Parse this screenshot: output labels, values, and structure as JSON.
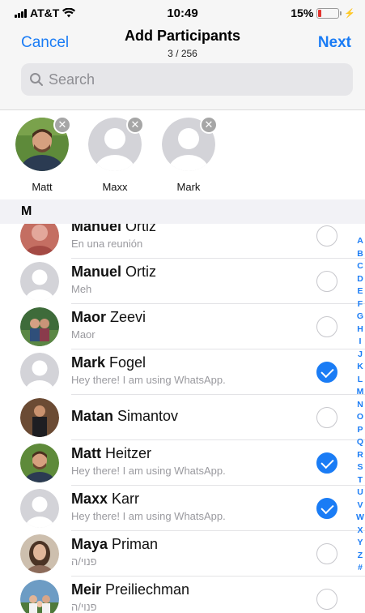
{
  "status_bar": {
    "carrier": "AT&T",
    "time": "10:49",
    "battery_percent_text": "15%",
    "battery_level": 0.15
  },
  "header": {
    "cancel_label": "Cancel",
    "title": "Add Participants",
    "count": "3 / 256",
    "next_label": "Next"
  },
  "search": {
    "placeholder": "Search",
    "value": ""
  },
  "selected": [
    {
      "name": "Matt",
      "avatar": "photo"
    },
    {
      "name": "Maxx",
      "avatar": "placeholder"
    },
    {
      "name": "Mark",
      "avatar": "placeholder"
    }
  ],
  "section_letter": "M",
  "contacts": [
    {
      "first": "Manuel",
      "last": " Ortiz",
      "status": "En una reunión",
      "checked": false,
      "avatar": "photo"
    },
    {
      "first": "Manuel",
      "last": " Ortiz",
      "status": "Meh",
      "checked": false,
      "avatar": "placeholder"
    },
    {
      "first": "Maor",
      "last": " Zeevi",
      "status": "Maor",
      "checked": false,
      "avatar": "photo"
    },
    {
      "first": "Mark",
      "last": " Fogel",
      "status": "Hey there! I am using WhatsApp.",
      "checked": true,
      "avatar": "placeholder"
    },
    {
      "first": "Matan",
      "last": " Simantov",
      "status": "",
      "checked": false,
      "avatar": "photo"
    },
    {
      "first": "Matt",
      "last": " Heitzer",
      "status": "Hey there! I am using WhatsApp.",
      "checked": true,
      "avatar": "photo"
    },
    {
      "first": "Maxx",
      "last": " Karr",
      "status": "Hey there! I am using WhatsApp.",
      "checked": true,
      "avatar": "placeholder"
    },
    {
      "first": "Maya",
      "last": " Priman",
      "status": "פנוי/ה",
      "checked": false,
      "avatar": "photo"
    },
    {
      "first": "Meir",
      "last": " Preiliechman",
      "status": "פנוי/ה",
      "checked": false,
      "avatar": "photo"
    }
  ],
  "index_letters": [
    "A",
    "B",
    "C",
    "D",
    "E",
    "F",
    "G",
    "H",
    "I",
    "J",
    "K",
    "L",
    "M",
    "N",
    "O",
    "P",
    "Q",
    "R",
    "S",
    "T",
    "U",
    "V",
    "W",
    "X",
    "Y",
    "Z",
    "#"
  ],
  "colors": {
    "accent": "#1a7cf5",
    "placeholder_avatar": "#c9c9ce"
  }
}
